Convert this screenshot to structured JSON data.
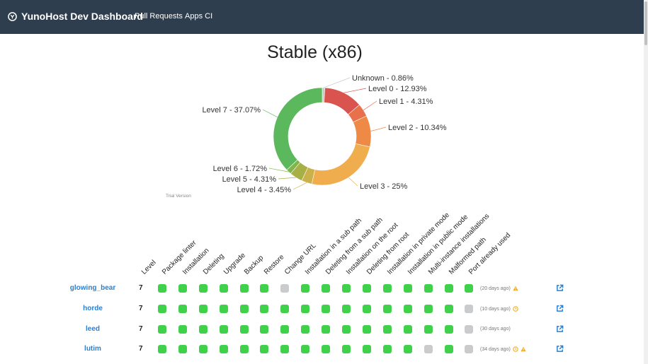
{
  "nav": {
    "brand": "YunoHost Dev Dashboard",
    "links": [
      "Pull Requests",
      "Apps CI"
    ]
  },
  "chart_title": "Stable (x86)",
  "chart_data": {
    "type": "pie",
    "title": "Stable (x86)",
    "slices": [
      {
        "label": "Unknown - 0.86%",
        "value": 0.86,
        "color": "#c9c9c9"
      },
      {
        "label": "Level 0 - 12.93%",
        "value": 12.93,
        "color": "#d9534f"
      },
      {
        "label": "Level 1 - 4.31%",
        "value": 4.31,
        "color": "#e8704a"
      },
      {
        "label": "Level 2 - 10.34%",
        "value": 10.34,
        "color": "#ee8a46"
      },
      {
        "label": "Level 3 - 25%",
        "value": 25.0,
        "color": "#f0ad4e"
      },
      {
        "label": "Level 4 - 3.45%",
        "value": 3.45,
        "color": "#cbb14a"
      },
      {
        "label": "Level 5 - 4.31%",
        "value": 4.31,
        "color": "#a7b044"
      },
      {
        "label": "Level 6 - 1.72%",
        "value": 1.72,
        "color": "#82b44e"
      },
      {
        "label": "Level 7 - 37.07%",
        "value": 37.07,
        "color": "#5cb85c"
      }
    ],
    "watermark": "Trial Version"
  },
  "table": {
    "headers": [
      "Level",
      "Package linter",
      "Installation",
      "Deleting",
      "Upgrade",
      "Backup",
      "Restore",
      "Change URL",
      "Installation in a sub path",
      "Deleting from a sub path",
      "Installation on the root",
      "Deleting from root",
      "Installation in private mode",
      "Installation in public mode",
      "Multi-instance installations",
      "Malformed path",
      "Port already used"
    ],
    "rows": [
      {
        "name": "glowing_bear",
        "level": "7",
        "cells": [
          "ok",
          "ok",
          "ok",
          "ok",
          "ok",
          "ok",
          "none",
          "ok",
          "ok",
          "ok",
          "ok",
          "ok",
          "ok",
          "ok",
          "ok",
          "ok"
        ],
        "age": "(20 days ago)",
        "icons": [
          "warning"
        ]
      },
      {
        "name": "horde",
        "level": "7",
        "cells": [
          "ok",
          "ok",
          "ok",
          "ok",
          "ok",
          "ok",
          "ok",
          "ok",
          "ok",
          "ok",
          "ok",
          "ok",
          "ok",
          "ok",
          "ok",
          "none"
        ],
        "age": "(10 days ago)",
        "icons": [
          "clock"
        ]
      },
      {
        "name": "leed",
        "level": "7",
        "cells": [
          "ok",
          "ok",
          "ok",
          "ok",
          "ok",
          "ok",
          "ok",
          "ok",
          "ok",
          "ok",
          "ok",
          "ok",
          "ok",
          "ok",
          "ok",
          "none"
        ],
        "age": "(30 days ago)",
        "icons": []
      },
      {
        "name": "lutim",
        "level": "7",
        "cells": [
          "ok",
          "ok",
          "ok",
          "ok",
          "ok",
          "ok",
          "ok",
          "ok",
          "ok",
          "ok",
          "ok",
          "ok",
          "ok",
          "none",
          "ok",
          "none"
        ],
        "age": "(34 days ago)",
        "icons": [
          "clock",
          "warning"
        ]
      }
    ]
  },
  "colors": {
    "navbar": "#2f3e4e",
    "success": "#3fd14a",
    "none": "#c9cbcd",
    "link": "#2a7fd0",
    "warning": "#f0ad1e"
  }
}
